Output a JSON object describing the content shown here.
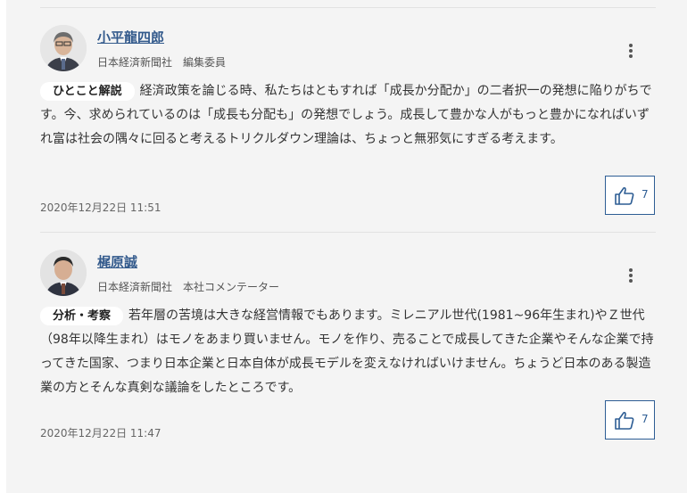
{
  "comments": [
    {
      "author": "小平龍四郎",
      "meta": "日本経済新聞社　編集委員",
      "badge": "ひとこと解説",
      "text": "経済政策を論じる時、私たちはともすれば「成長か分配か」の二者択一の発想に陥りがちです。今、求められているのは「成長も分配も」の発想でしょう。成長して豊かな人がもっと豊かになればいずれ富は社会の隅々に回ると考えるトリクルダウン理論は、ちょっと無邪気にすぎる考えます。",
      "timestamp": "2020年12月22日 11:51",
      "likes": "7"
    },
    {
      "author": "梶原誠",
      "meta": "日本経済新聞社　本社コメンテーター",
      "badge": "分析・考察",
      "text": "若年層の苦境は大きな経営情報でもあります。ミレニアル世代(1981~96年生まれ)やＺ世代（98年以降生まれ）はモノをあまり買いません。モノを作り、売ることで成長してきた企業やそんな企業で持ってきた国家、つまり日本企業と日本自体が成長モデルを変えなければいけません。ちょうど日本のある製造業の方とそんな真剣な議論をしたところです。",
      "timestamp": "2020年12月22日 11:47",
      "likes": "7"
    }
  ]
}
